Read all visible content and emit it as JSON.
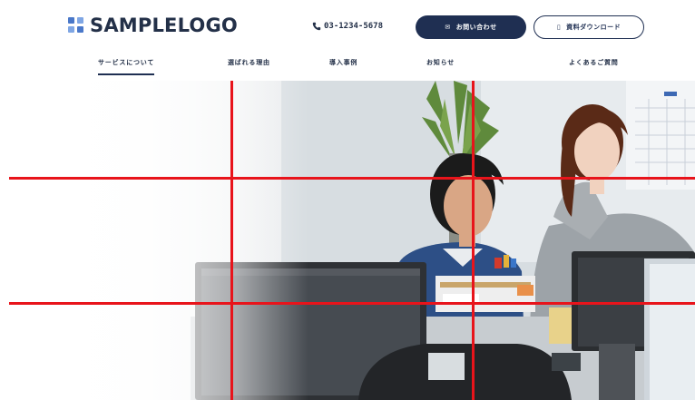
{
  "header": {
    "logo_text": "SAMPLELOGO",
    "logo_icon": "grid-logo-icon",
    "phone_icon": "phone-icon",
    "phone_number": "03-1234-5678",
    "contact_button_icon": "mail-icon",
    "contact_button_label": "お問い合わせ",
    "download_button_icon": "document-icon",
    "download_button_label": "資料ダウンロード"
  },
  "nav": {
    "items": [
      {
        "label": "サービスについて",
        "active": true
      },
      {
        "label": "選ばれる理由",
        "active": false
      },
      {
        "label": "導入事例",
        "active": false
      },
      {
        "label": "お知らせ",
        "active": false
      },
      {
        "label": "よくあるご質問",
        "active": false
      }
    ]
  },
  "colors": {
    "brand_navy": "#1f2f52",
    "logo_blue": "#4a78c9",
    "logo_light_blue": "#7fa6e4",
    "grid_red": "#e8141b",
    "background": "#ffffff"
  },
  "hero": {
    "image_description_icon": "office-photo-image"
  }
}
